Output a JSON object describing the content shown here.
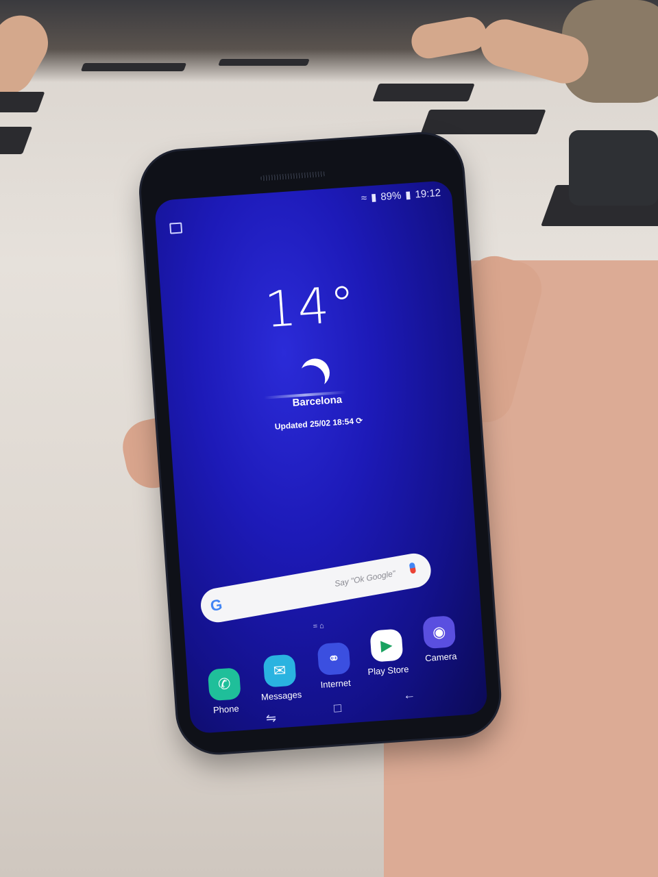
{
  "status_bar": {
    "signal_icon": "signal-icon",
    "wifi_icon": "wifi-icon",
    "battery_percent": "89%",
    "battery_icon": "battery-icon",
    "time": "19:12"
  },
  "weather": {
    "temperature": "14°",
    "condition_icon": "moon-icon",
    "city": "Barcelona",
    "updated": "Updated 25/02 18:54",
    "refresh_icon": "refresh-icon"
  },
  "search": {
    "logo": "G",
    "hint": "Say \"Ok Google\"",
    "mic_icon": "mic-icon"
  },
  "dock": {
    "apps": [
      {
        "label": "Phone",
        "icon": "phone-icon",
        "color": "#1fbf9a"
      },
      {
        "label": "Messages",
        "icon": "messages-icon",
        "color": "#2ab3e0"
      },
      {
        "label": "Internet",
        "icon": "internet-icon",
        "color": "#3b4fe0"
      },
      {
        "label": "Play Store",
        "icon": "play-store-icon",
        "color": "#ffffff"
      },
      {
        "label": "Camera",
        "icon": "camera-icon",
        "color": "#5a4fe0"
      }
    ]
  },
  "nav": {
    "recents_icon": "recents-icon",
    "home_icon": "home-icon",
    "back_icon": "back-icon"
  },
  "colors": {
    "screen_blue": "#1d1ab8",
    "table": "#e6e1db",
    "phone_body": "#0f1118"
  }
}
